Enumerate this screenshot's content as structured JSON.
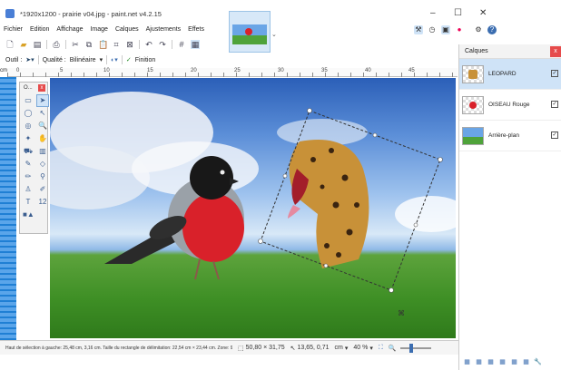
{
  "window": {
    "title": "*1920x1200 - prairie v04.jpg - paint.net v4.2.15",
    "minimize": "–",
    "maximize": "☐",
    "close": "✕"
  },
  "menu": [
    "Fichier",
    "Edition",
    "Affichage",
    "Image",
    "Calques",
    "Ajustements",
    "Effets"
  ],
  "toolbar2": {
    "tool_label": "Outil :",
    "quality_label": "Qualité :",
    "quality_value": "Bilinéaire",
    "finish_label": "Finition"
  },
  "ruler": {
    "unit": "cm",
    "labels": [
      "0",
      "5",
      "10",
      "15",
      "20",
      "25",
      "30",
      "35",
      "40",
      "45"
    ]
  },
  "tools_panel": {
    "title": "O...",
    "close": "x",
    "text_tool": "T",
    "number_tool": "12"
  },
  "layers_panel": {
    "title": "Calques",
    "close": "x",
    "layers": [
      {
        "name": "LEOPARD",
        "visible": true,
        "selected": true
      },
      {
        "name": "OISEAU Rouge",
        "visible": true,
        "selected": false
      },
      {
        "name": "Arrière-plan",
        "visible": true,
        "selected": false
      }
    ]
  },
  "status": {
    "info": "Haut de sélection à gauche: 25,48 cm, 3,16 cm. Taille du rectangle de délimitation: 22,54 cm × 23,44 cm. Zone: 90,08 cm...",
    "selection_size": "50,80 × 31,75",
    "cursor_pos": "13,65, 0,71",
    "unit": "cm",
    "zoom": "40 %"
  },
  "colors": {
    "accent": "#1f7fd4",
    "selected_layer": "#cfe3f7",
    "close_red": "#e64b4b"
  }
}
